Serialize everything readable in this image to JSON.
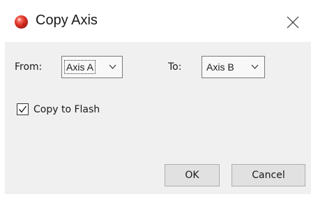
{
  "window": {
    "title": "Copy Axis",
    "icon": "red-circle-app-icon",
    "close_icon": "close-x-icon"
  },
  "form": {
    "from_label": "From:",
    "from_value": "Axis A",
    "to_label": "To:",
    "to_value": "Axis B",
    "copy_to_flash_label": "Copy to Flash",
    "copy_to_flash_checked": true
  },
  "buttons": {
    "ok_label": "OK",
    "cancel_label": "Cancel"
  },
  "colors": {
    "dialog_bg": "#f0f0f0",
    "titlebar_bg": "#ffffff",
    "icon_red": "#d9322b"
  }
}
